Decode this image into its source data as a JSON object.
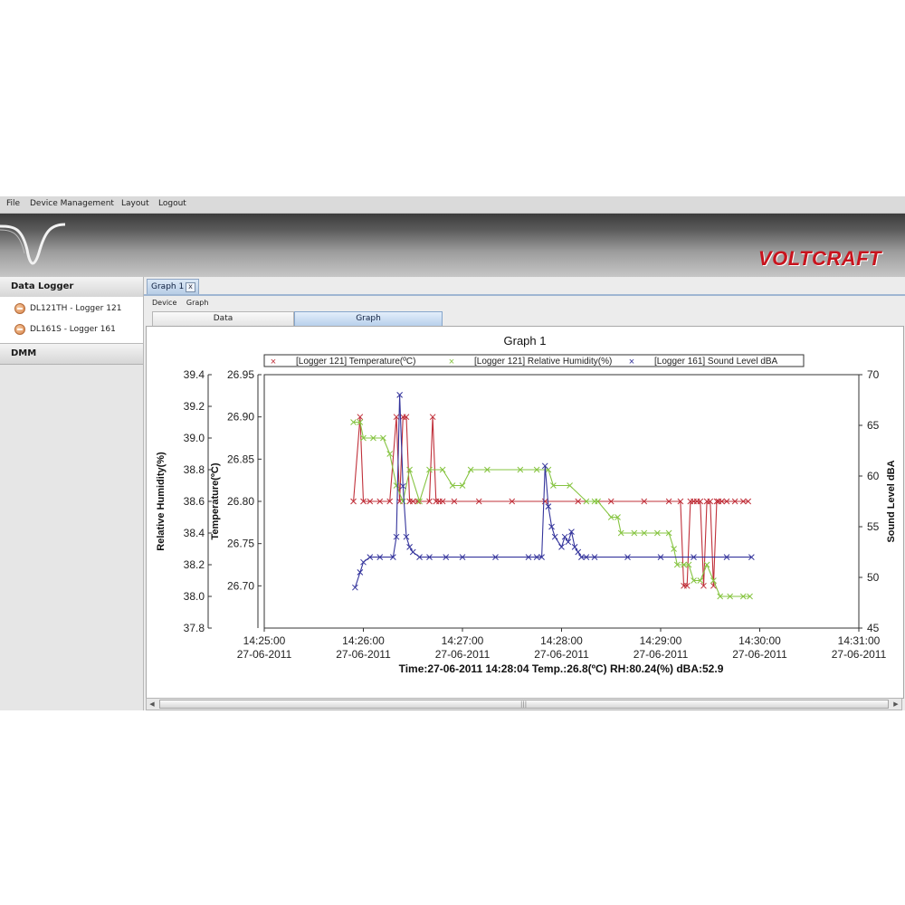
{
  "menu": [
    "File",
    "Device Management",
    "Layout",
    "Logout"
  ],
  "brand": "VOLTCRAFT",
  "sidebar": {
    "section_data_logger": "Data Logger",
    "devices": [
      "DL121TH - Logger 121",
      "DL161S - Logger 161"
    ],
    "section_dmm": "DMM"
  },
  "doc_tab": {
    "label": "Graph 1",
    "close": "x"
  },
  "breadcrumb": [
    "Device",
    "Graph"
  ],
  "subtabs": {
    "data": "Data",
    "graph": "Graph"
  },
  "hscroll": {
    "left": "◀",
    "right": "▶",
    "grip": "|||"
  },
  "chart_data": {
    "type": "line",
    "title": "Graph 1",
    "legend_placement": "top-center",
    "grid": false,
    "series": [
      {
        "name": "[Logger 121] Temperature(ºC)",
        "color": "#c0303a",
        "marker": "×",
        "axis": "temperature",
        "x": [
          "14:25:54",
          "14:25:58",
          "14:26:00",
          "14:26:04",
          "14:26:10",
          "14:26:16",
          "14:26:20",
          "14:26:22",
          "14:26:24",
          "14:26:26",
          "14:26:28",
          "14:26:30",
          "14:26:33",
          "14:26:40",
          "14:26:42",
          "14:26:44",
          "14:26:46",
          "14:26:48",
          "14:26:55",
          "14:27:10",
          "14:27:30",
          "14:27:50",
          "14:28:10",
          "14:28:30",
          "14:28:50",
          "14:29:05",
          "14:29:12",
          "14:29:14",
          "14:29:16",
          "14:29:18",
          "14:29:20",
          "14:29:22",
          "14:29:24",
          "14:29:26",
          "14:29:28",
          "14:29:30",
          "14:29:32",
          "14:29:34",
          "14:29:35",
          "14:29:37",
          "14:29:40",
          "14:29:45",
          "14:29:50",
          "14:29:53"
        ],
        "y": [
          26.8,
          26.9,
          26.8,
          26.8,
          26.8,
          26.8,
          26.9,
          26.8,
          26.9,
          26.9,
          26.8,
          26.8,
          26.8,
          26.8,
          26.9,
          26.8,
          26.8,
          26.8,
          26.8,
          26.8,
          26.8,
          26.8,
          26.8,
          26.8,
          26.8,
          26.8,
          26.8,
          26.7,
          26.7,
          26.8,
          26.8,
          26.8,
          26.8,
          26.7,
          26.8,
          26.8,
          26.7,
          26.8,
          26.8,
          26.8,
          26.8,
          26.8,
          26.8,
          26.8
        ]
      },
      {
        "name": "[Logger 121] Relative Humidity(%)",
        "color": "#86c441",
        "marker": "×",
        "axis": "humidity",
        "x": [
          "14:25:54",
          "14:25:58",
          "14:26:00",
          "14:26:06",
          "14:26:12",
          "14:26:16",
          "14:26:20",
          "14:26:24",
          "14:26:28",
          "14:26:34",
          "14:26:40",
          "14:26:48",
          "14:26:54",
          "14:27:00",
          "14:27:05",
          "14:27:15",
          "14:27:35",
          "14:27:45",
          "14:27:52",
          "14:27:55",
          "14:28:05",
          "14:28:15",
          "14:28:20",
          "14:28:22",
          "14:28:30",
          "14:28:34",
          "14:28:36",
          "14:28:44",
          "14:28:50",
          "14:28:58",
          "14:29:05",
          "14:29:08",
          "14:29:10",
          "14:29:14",
          "14:29:17",
          "14:29:20",
          "14:29:24",
          "14:29:28",
          "14:29:32",
          "14:29:36",
          "14:29:42",
          "14:29:50",
          "14:29:54"
        ],
        "y": [
          39.1,
          39.1,
          39.0,
          39.0,
          39.0,
          38.9,
          38.7,
          38.6,
          38.8,
          38.6,
          38.8,
          38.8,
          38.7,
          38.7,
          38.8,
          38.8,
          38.8,
          38.8,
          38.8,
          38.7,
          38.7,
          38.6,
          38.6,
          38.6,
          38.5,
          38.5,
          38.4,
          38.4,
          38.4,
          38.4,
          38.4,
          38.3,
          38.2,
          38.2,
          38.2,
          38.1,
          38.1,
          38.2,
          38.1,
          38.0,
          38.0,
          38.0,
          38.0
        ]
      },
      {
        "name": "[Logger 161] Sound Level dBA",
        "color": "#34349c",
        "marker": "×",
        "axis": "sound",
        "x": [
          "14:25:55",
          "14:25:58",
          "14:26:00",
          "14:26:04",
          "14:26:10",
          "14:26:18",
          "14:26:20",
          "14:26:22",
          "14:26:24",
          "14:26:26",
          "14:26:28",
          "14:26:30",
          "14:26:34",
          "14:26:40",
          "14:26:50",
          "14:27:00",
          "14:27:20",
          "14:27:40",
          "14:27:45",
          "14:27:48",
          "14:27:50",
          "14:27:52",
          "14:27:54",
          "14:27:56",
          "14:28:00",
          "14:28:02",
          "14:28:04",
          "14:28:06",
          "14:28:08",
          "14:28:10",
          "14:28:12",
          "14:28:15",
          "14:28:20",
          "14:28:40",
          "14:29:00",
          "14:29:20",
          "14:29:40",
          "14:29:55"
        ],
        "y": [
          49.0,
          50.5,
          51.5,
          52.0,
          52.0,
          52.0,
          54.0,
          68.0,
          59.0,
          54.0,
          53.0,
          52.5,
          52.0,
          52.0,
          52.0,
          52.0,
          52.0,
          52.0,
          52.0,
          52.0,
          61.0,
          57.0,
          55.0,
          54.0,
          53.0,
          54.0,
          53.5,
          54.5,
          53.0,
          52.5,
          52.0,
          52.0,
          52.0,
          52.0,
          52.0,
          52.0,
          52.0,
          52.0
        ]
      }
    ],
    "axes": {
      "humidity": {
        "label": "Relative Humidity(%)",
        "ylim": [
          37.8,
          39.4
        ],
        "ticks": [
          "39.4",
          "39.2",
          "39.0",
          "38.8",
          "38.6",
          "38.4",
          "38.2",
          "38.0",
          "37.8"
        ]
      },
      "temperature": {
        "label": "Temperature(ºC)",
        "ylim": [
          26.65,
          26.95
        ],
        "ticks": [
          "26.95",
          "26.90",
          "26.85",
          "26.80",
          "26.75",
          "26.70"
        ]
      },
      "sound": {
        "label": "Sound Level dBA",
        "ylim": [
          45,
          70
        ],
        "ticks": [
          "70",
          "65",
          "60",
          "55",
          "50",
          "45"
        ]
      },
      "x": {
        "range": [
          "14:25:00",
          "14:31:00"
        ],
        "ticks": [
          {
            "time": "14:25:00",
            "date": "27-06-2011"
          },
          {
            "time": "14:26:00",
            "date": "27-06-2011"
          },
          {
            "time": "14:27:00",
            "date": "27-06-2011"
          },
          {
            "time": "14:28:00",
            "date": "27-06-2011"
          },
          {
            "time": "14:29:00",
            "date": "27-06-2011"
          },
          {
            "time": "14:30:00",
            "date": "27-06-2011"
          },
          {
            "time": "14:31:00",
            "date": "27-06-2011"
          }
        ]
      }
    },
    "status": "Time:27-06-2011 14:28:04 Temp.:26.8(ºC) RH:80.24(%) dBA:52.9"
  }
}
